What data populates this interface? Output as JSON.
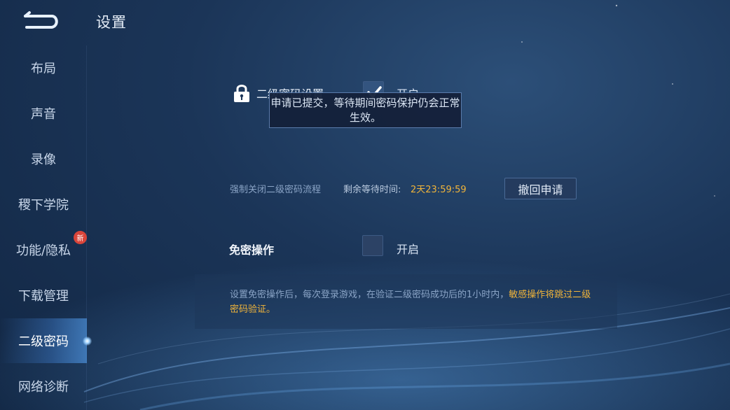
{
  "header": {
    "title": "设置",
    "back": "back-arrow-icon"
  },
  "sidebar": {
    "items": [
      {
        "label": "布局"
      },
      {
        "label": "声音"
      },
      {
        "label": "录像"
      },
      {
        "label": "稷下学院"
      },
      {
        "label": "功能/隐私",
        "badge": "新"
      },
      {
        "label": "下载管理"
      },
      {
        "label": "二级密码",
        "active": true
      },
      {
        "label": "网络诊断"
      }
    ]
  },
  "main": {
    "second_password": {
      "label": "二级密码设置",
      "toggle_label": "开启",
      "checked": true,
      "icon": "lock-icon"
    },
    "tooltip": "申请已提交，等待期间密码保护仍会正常生效。",
    "force_close": {
      "label": "强制关闭二级密码流程",
      "remaining_label": "剩余等待时间:",
      "remaining_value": "2天23:59:59",
      "withdraw_button": "撤回申请"
    },
    "password_free": {
      "label": "免密操作",
      "toggle_label": "开启",
      "checked": false
    },
    "info": {
      "text": "设置免密操作后，每次登录游戏，在验证二级密码成功后的1小时内，",
      "highlight": "敏感操作将跳过二级密码验证。"
    }
  },
  "colors": {
    "accent_gold": "#f0b43a",
    "badge_red": "#d9453a"
  }
}
